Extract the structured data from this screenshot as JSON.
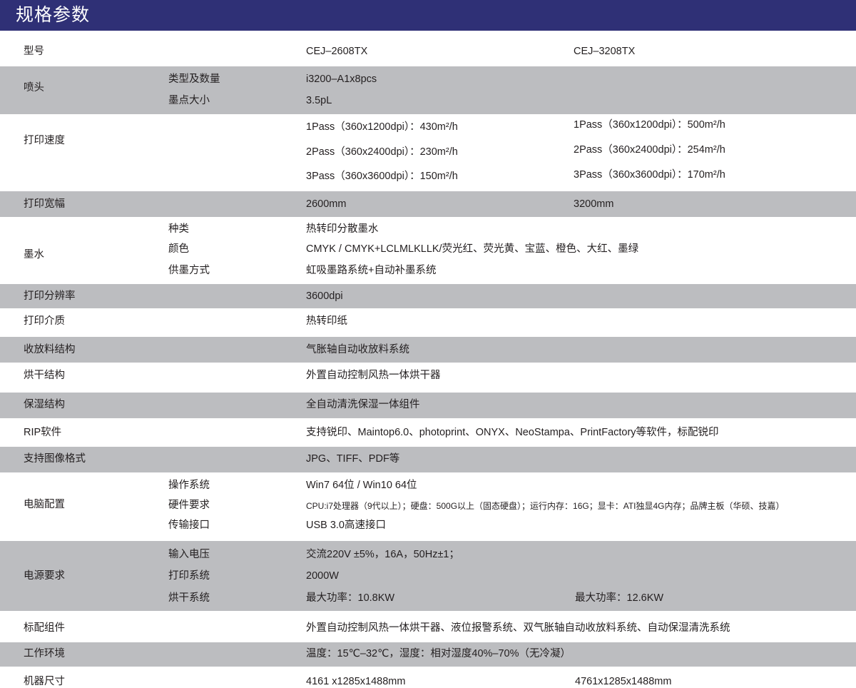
{
  "header": {
    "title": "规格参数"
  },
  "specs": {
    "model": {
      "label": "型号",
      "v1": "CEJ–2608TX",
      "v2": "CEJ–3208TX"
    },
    "head": {
      "label": "喷头",
      "sub1": "类型及数量",
      "val1": "i3200–A1x8pcs",
      "sub2": "墨点大小",
      "val2": "3.5pL"
    },
    "speed": {
      "label": "打印速度",
      "c1": [
        "1Pass（360x1200dpi）：430m²/h",
        "2Pass（360x2400dpi）：230m²/h",
        "3Pass（360x3600dpi）：150m²/h"
      ],
      "c2": [
        "1Pass（360x1200dpi）：500m²/h",
        "2Pass（360x2400dpi）：254m²/h",
        "3Pass（360x3600dpi）：170m²/h"
      ]
    },
    "width": {
      "label": "打印宽幅",
      "v1": "2600mm",
      "v2": "3200mm"
    },
    "ink": {
      "label": "墨水",
      "sub1": "种类",
      "val1": "热转印分散墨水",
      "sub2": "颜色",
      "val2": "CMYK / CMYK+LCLMLKLLK/荧光红、荧光黄、宝蓝、橙色、大红、墨绿",
      "sub3": "供墨方式",
      "val3": "虹吸墨路系统+自动补墨系统"
    },
    "resolution": {
      "label": "打印分辨率",
      "value": "3600dpi"
    },
    "media": {
      "label": "打印介质",
      "value": "热转印纸"
    },
    "feed": {
      "label": "收放料结构",
      "value": "气胀轴自动收放料系统"
    },
    "dryer": {
      "label": "烘干结构",
      "value": "外置自动控制风热一体烘干器"
    },
    "moist": {
      "label": "保湿结构",
      "value": "全自动清洗保湿一体组件"
    },
    "rip": {
      "label": "RIP软件",
      "value": "支持锐印、Maintop6.0、photoprint、ONYX、NeoStampa、PrintFactory等软件，标配锐印"
    },
    "formats": {
      "label": "支持图像格式",
      "value": "JPG、TIFF、PDF等"
    },
    "pc": {
      "label": "电脑配置",
      "sub1": "操作系统",
      "val1": "Win7 64位 / Win10 64位",
      "sub2": "硬件要求",
      "val2": "CPU:i7处理器（9代以上）；硬盘：500G以上（固态硬盘）；运行内存：16G；显卡：ATI独显4G内存；品牌主板（华硕、技嘉）",
      "sub3": "传输接口",
      "val3": "USB 3.0高速接口"
    },
    "power": {
      "label": "电源要求",
      "sub1": "输入电压",
      "val1": "交流220V ±5%，16A，50Hz±1；",
      "sub2": "打印系统",
      "val2": "2000W",
      "sub3": "烘干系统",
      "val3a": "最大功率：10.8KW",
      "val3b": "最大功率：12.6KW"
    },
    "standard": {
      "label": "标配组件",
      "value": "外置自动控制风热一体烘干器、液位报警系统、双气胀轴自动收放料系统、自动保湿清洗系统"
    },
    "env": {
      "label": "工作环境",
      "value": "温度：15℃–32℃，湿度：相对湿度40%–70%（无冷凝）"
    },
    "size": {
      "label": "机器尺寸",
      "v1": "4161 x1285x1488mm",
      "v2": "4761x1285x1488mm"
    }
  }
}
